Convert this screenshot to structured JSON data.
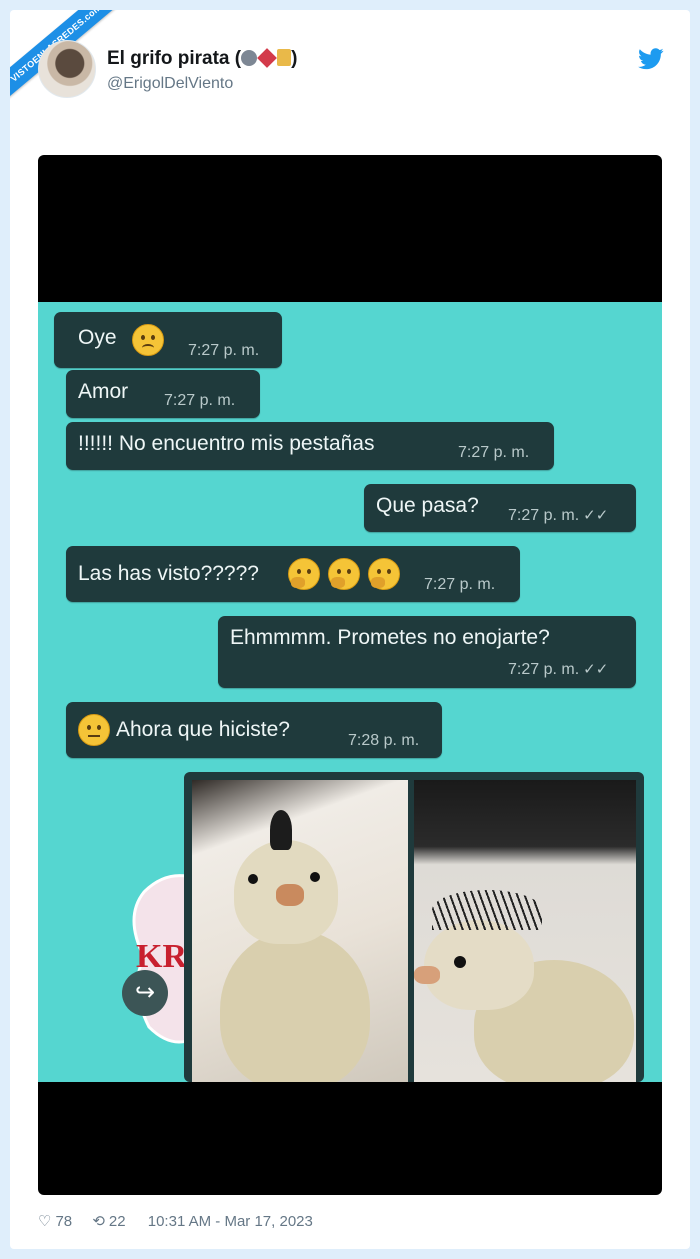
{
  "watermark": "VISTOENLASREDES.com",
  "tweet": {
    "name": "El grifo pirata (",
    "name_close": ")",
    "handle": "@ErigolDelViento",
    "likes": "78",
    "retweets": "22",
    "timestamp": "10:31 AM - Mar 17, 2023"
  },
  "chat": {
    "messages": [
      {
        "text": "Oye",
        "time": "7:27 p. m."
      },
      {
        "text": "Amor",
        "time": "7:27 p. m."
      },
      {
        "text": "!!!!!! No encuentro mis pestañas",
        "time": "7:27 p. m."
      },
      {
        "text": "Que pasa?",
        "time": "7:27 p. m."
      },
      {
        "text": "Las has visto?????",
        "time": "7:27 p. m."
      },
      {
        "text": "Ehmmmm. Prometes no enojarte?",
        "time": "7:27 p. m."
      },
      {
        "text": "Ahora que hiciste?",
        "time": "7:28 p. m."
      }
    ],
    "sticker_text": "KR"
  },
  "colors": {
    "chat_background": "#55d6d0",
    "bubble": "#1f3a3c",
    "twitter_blue": "#1d9bf0"
  }
}
